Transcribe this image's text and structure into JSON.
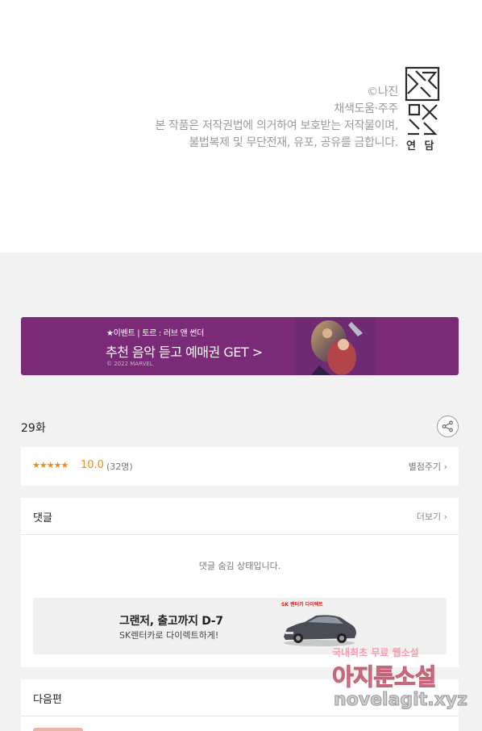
{
  "copyright": {
    "lines": [
      "©나진",
      "채색도움·주주",
      "본 작품은 저작권법에 의거하여 보호받는 저작물이며,",
      "불법복제 및 무단전재, 유포, 공유를 금합니다."
    ],
    "logo_text": "연 담",
    "logo_icon": "yeondam-logo-icon"
  },
  "banner": {
    "small_text": "★이벤트 | 토르 : 러브 앤 썬더",
    "big_text": "추천 음악 듣고 예매권 GET >",
    "copyright_text": "© 2022 MARVEL"
  },
  "episode": {
    "title": "29화",
    "share_icon": "share-icon"
  },
  "rating": {
    "stars": "★★★★★",
    "score": "10.0",
    "count": "(32명)",
    "rate_button": "별점주기 ›"
  },
  "comments": {
    "title": "댓글",
    "more": "더보기 ›",
    "hidden_message": "댓글 숨김 상태입니다."
  },
  "ad": {
    "title": "그랜저, 출고까지 D-7",
    "subtitle": "SK렌터카로 다이렉트하게!",
    "brand": "SK 렌터카 다이렉트"
  },
  "next": {
    "title": "다음편"
  },
  "watermark": {
    "line1": "국내최초 무료 웹소설",
    "line2": "아지툰소설",
    "line3": "novelagit.xyz"
  },
  "colors": {
    "accent_orange": "#ef8b1b",
    "banner_purple": "#7b2a78",
    "page_bg": "#f2f2f2"
  }
}
